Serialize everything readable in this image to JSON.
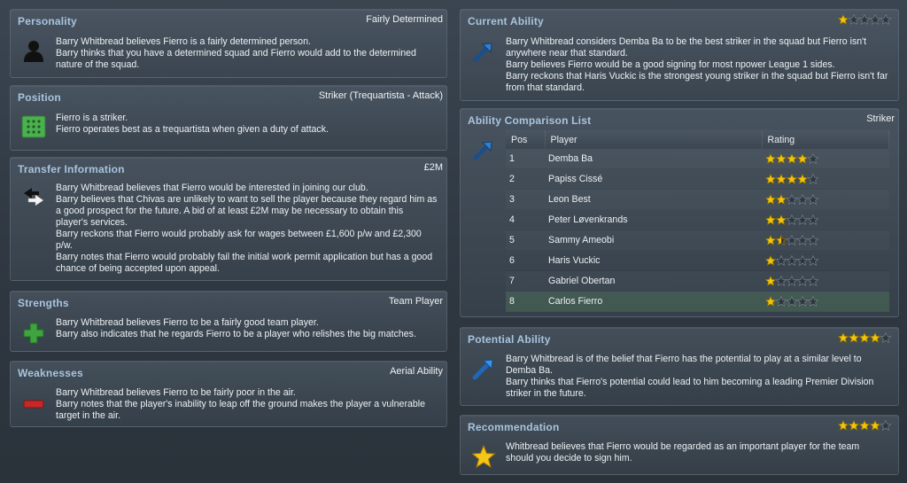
{
  "personality": {
    "title": "Personality",
    "value": "Fairly Determined",
    "icon": "person-silhouette-icon",
    "lines": [
      "Barry Whitbread believes Fierro is a fairly determined person.",
      "Barry thinks that you have a determined squad and Fierro would add to the determined nature of the squad."
    ]
  },
  "position": {
    "title": "Position",
    "value": "Striker (Trequartista - Attack)",
    "icon": "pitch-icon",
    "lines": [
      "Fierro is a striker.",
      "Fierro operates best as a trequartista when given a duty of attack."
    ]
  },
  "transfer": {
    "title": "Transfer Information",
    "value": "£2M",
    "icon": "transfer-arrows-icon",
    "lines": [
      "Barry Whitbread believes that Fierro would be interested in joining our club.",
      "Barry believes that Chivas are unlikely to want to sell the player because they regard him as a good prospect for the future. A bid of at least £2M may be necessary to obtain this player's services.",
      "Barry reckons that Fierro would probably ask for wages between £1,600 p/w and £2,300 p/w.",
      "Barry notes that Fierro would probably fail the initial work permit application but has a good chance of being accepted upon appeal."
    ]
  },
  "strengths": {
    "title": "Strengths",
    "value": "Team Player",
    "icon": "plus-icon",
    "lines": [
      "Barry Whitbread believes Fierro to be a fairly good team player.",
      "Barry also indicates that he regards Fierro to be a player who relishes the big matches."
    ]
  },
  "weaknesses": {
    "title": "Weaknesses",
    "value": "Aerial Ability",
    "icon": "minus-icon",
    "lines": [
      "Barry Whitbread believes Fierro to be fairly poor in the air.",
      "Barry notes that the player's inability to leap off the ground makes the player a vulnerable target in the air."
    ]
  },
  "current_ability": {
    "title": "Current Ability",
    "stars": 1,
    "icon": "ability-arrow-icon",
    "lines": [
      "Barry Whitbread considers Demba Ba to be the best striker in the squad but Fierro isn't anywhere near that standard.",
      "Barry believes Fierro would be a good signing for most npower League 1 sides.",
      "Barry reckons that Haris Vuckic is the strongest young striker in the squad but Fierro isn't far from that standard."
    ]
  },
  "comparison": {
    "title": "Ability Comparison List",
    "value": "Striker",
    "icon": "ability-arrow-icon",
    "headers": {
      "pos": "Pos",
      "player": "Player",
      "rating": "Rating"
    },
    "rows": [
      {
        "pos": "1",
        "player": "Demba Ba",
        "stars": 4
      },
      {
        "pos": "2",
        "player": "Papiss Cissé",
        "stars": 4
      },
      {
        "pos": "3",
        "player": "Leon Best",
        "stars": 2
      },
      {
        "pos": "4",
        "player": "Peter Løvenkrands",
        "stars": 2
      },
      {
        "pos": "5",
        "player": "Sammy Ameobi",
        "stars": 1.5
      },
      {
        "pos": "6",
        "player": "Haris Vuckic",
        "stars": 1
      },
      {
        "pos": "7",
        "player": "Gabriel Obertan",
        "stars": 1
      },
      {
        "pos": "8",
        "player": "Carlos Fierro",
        "stars": 1,
        "highlight": true
      }
    ]
  },
  "potential_ability": {
    "title": "Potential Ability",
    "stars": 4,
    "icon": "potential-arrow-icon",
    "lines": [
      "Barry Whitbread is of the belief that Fierro has the potential to play at a similar level to Demba Ba.",
      "Barry thinks that Fierro's potential could lead to him becoming a leading Premier Division striker in the future."
    ]
  },
  "recommendation": {
    "title": "Recommendation",
    "stars": 4,
    "icon": "gold-star-icon",
    "lines": [
      "Whitbread believes that Fierro would be regarded as an important player for the team should you decide to sign him."
    ]
  },
  "colors": {
    "title": "#a9c4df",
    "star_filled": "#f1c40f",
    "star_empty": "#2d353d",
    "highlight_row": "#50785a"
  }
}
